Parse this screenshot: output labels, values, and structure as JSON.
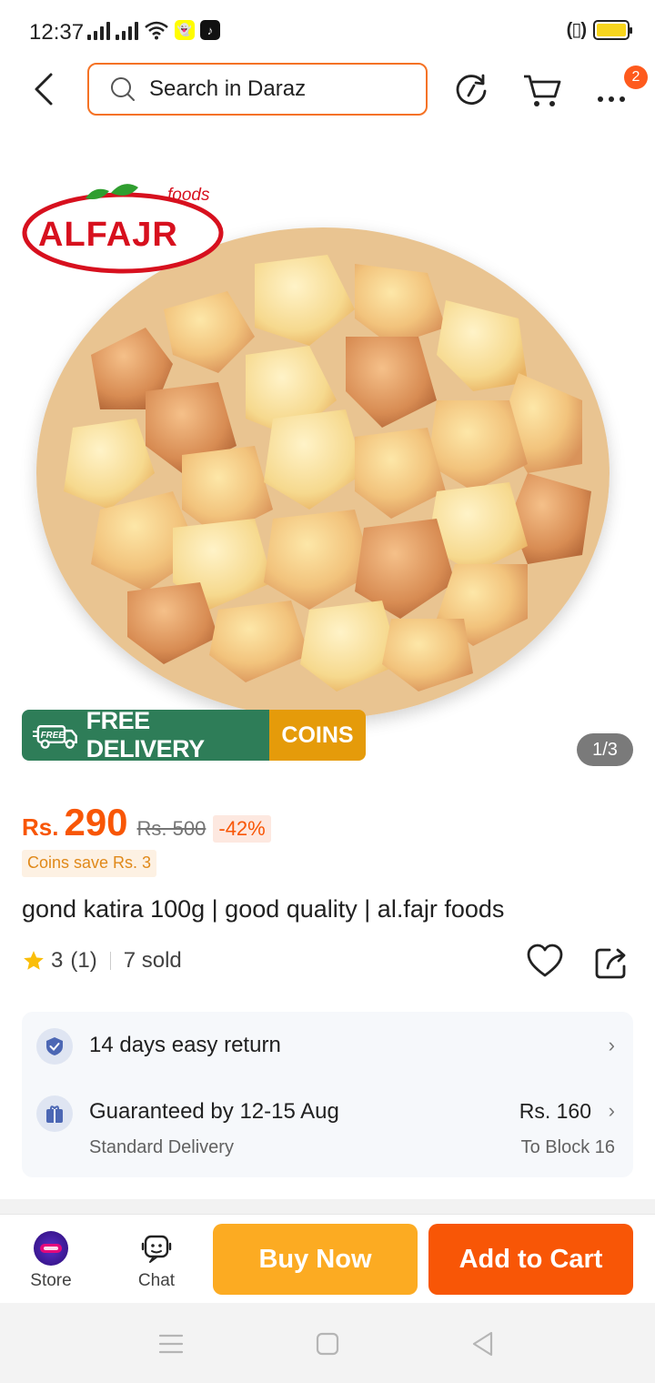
{
  "status_bar": {
    "time": "12:37",
    "icons": [
      "signal-icon",
      "signal-icon",
      "wifi-icon",
      "snapchat-icon",
      "tiktok-icon",
      "vibrate-icon",
      "battery-icon"
    ]
  },
  "header": {
    "search_placeholder": "Search in Daraz",
    "menu_badge_count": "2"
  },
  "gallery": {
    "logo_text": "ALFAJR",
    "logo_sub": "foods",
    "free_label": "FREE",
    "free_delivery": "FREE DELIVERY",
    "coins": "COINS",
    "counter": "1/3"
  },
  "product": {
    "currency": "Rs.",
    "price": "290",
    "old_price": "Rs. 500",
    "discount": "-42%",
    "coins_save": "Coins save Rs. 3",
    "title": "gond katira 100g | good quality | al.fajr foods",
    "rating": "3",
    "rating_count": "(1)",
    "sold": "7 sold"
  },
  "services": {
    "return_text": "14 days easy return",
    "delivery_text": "Guaranteed by 12-15 Aug",
    "delivery_type": "Standard Delivery",
    "delivery_price": "Rs. 160",
    "delivery_location": "To Block 16"
  },
  "bottom_bar": {
    "store_label": "Store",
    "chat_label": "Chat",
    "buy_now": "Buy Now",
    "add_to_cart": "Add to Cart"
  },
  "colors": {
    "accent": "#f85606",
    "buy_now": "#fcab22",
    "delivery_green": "#2e7d58",
    "coins_gold": "#e59b0a"
  }
}
